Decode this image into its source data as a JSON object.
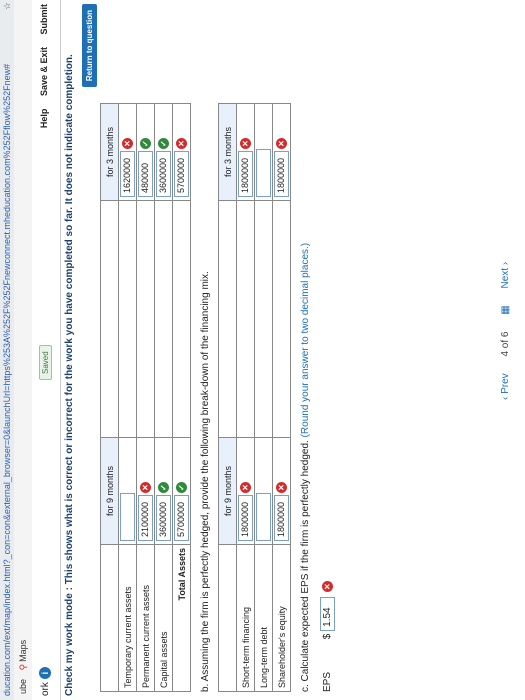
{
  "browser": {
    "url": "ducation.com/ext/map/index.html?_con=con&external_browser=0&launchUrl=https%253A%252F%252Fnewconnect.mheducation.com%252Fflow%252Fnew#",
    "bookmarks": [
      "ube",
      "Maps"
    ]
  },
  "header": {
    "work_label": "ork",
    "info": "i",
    "saved": "Saved",
    "help": "Help",
    "save_exit": "Save & Exit",
    "submit": "Submit"
  },
  "check_mode": "Check my work mode : This shows what is correct or incorrect for the work you have completed so far. It does not indicate completion.",
  "return_btn": "Return to question",
  "table_a": {
    "col1": "for 9 months",
    "col2": "for 3 months",
    "rows": [
      {
        "label": "Temporary current assets",
        "v1": "",
        "m1": "",
        "v2": "1620000",
        "m2": "x"
      },
      {
        "label": "Permanent current assets",
        "v1": "2100000",
        "m1": "x",
        "v2": "480000",
        "m2": "ok"
      },
      {
        "label": "Capital assets",
        "v1": "3600000",
        "m1": "ok",
        "v2": "3600000",
        "m2": "ok"
      },
      {
        "label": "Total Assets",
        "v1": "5700000",
        "m1": "ok",
        "v2": "5700000",
        "m2": "x"
      }
    ]
  },
  "part_b": "b. Assuming the firm is perfectly hedged, provide the following break-down of the financing mix.",
  "table_b": {
    "col1": "for 9 months",
    "col2": "for 3 months",
    "rows": [
      {
        "label": "Short-term financing",
        "v1": "1800000",
        "m1": "x",
        "v2": "1800000",
        "m2": "x"
      },
      {
        "label": "Long-term debt",
        "v1": "",
        "m1": "",
        "v2": "",
        "m2": ""
      },
      {
        "label": "Shareholder's equity",
        "v1": "1800000",
        "m1": "x",
        "v2": "1800000",
        "m2": "x"
      }
    ]
  },
  "part_c": "c. Calculate expected EPS if the firm is perfectly hedged.",
  "part_c_hint": "(Round your answer to two decimal places.)",
  "eps": {
    "label": "EPS",
    "currency": "$",
    "value": "1.54",
    "mark": "x"
  },
  "nav": {
    "prev": "Prev",
    "page": "4 of 6",
    "next": "Next"
  },
  "glyphs": {
    "ok": "✓",
    "x": "✕"
  }
}
